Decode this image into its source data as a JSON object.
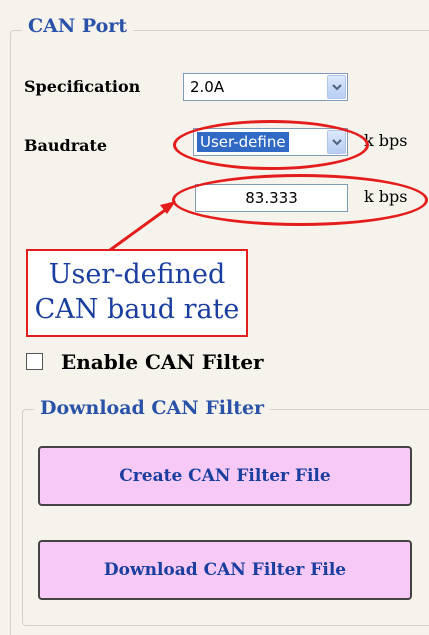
{
  "can_port": {
    "title": "CAN Port",
    "specification": {
      "label": "Specification",
      "value": "2.0A"
    },
    "baudrate": {
      "label": "Baudrate",
      "value": "User-define",
      "unit": "k bps"
    },
    "custom_baudrate": {
      "value": "83.333",
      "unit": "k bps"
    },
    "callout": {
      "line1": "User-defined",
      "line2": "CAN baud rate"
    },
    "enable_filter": {
      "label": "Enable CAN Filter",
      "checked": false
    }
  },
  "download_filter": {
    "title": "Download CAN Filter",
    "create_button": "Create CAN Filter File",
    "download_button": "Download CAN Filter File"
  },
  "colors": {
    "annotation": "#e41c1c",
    "button_fill": "#f6c9f6",
    "legend_text": "#2a52a8"
  },
  "icons": {
    "dropdown": "chevron-down-icon"
  }
}
